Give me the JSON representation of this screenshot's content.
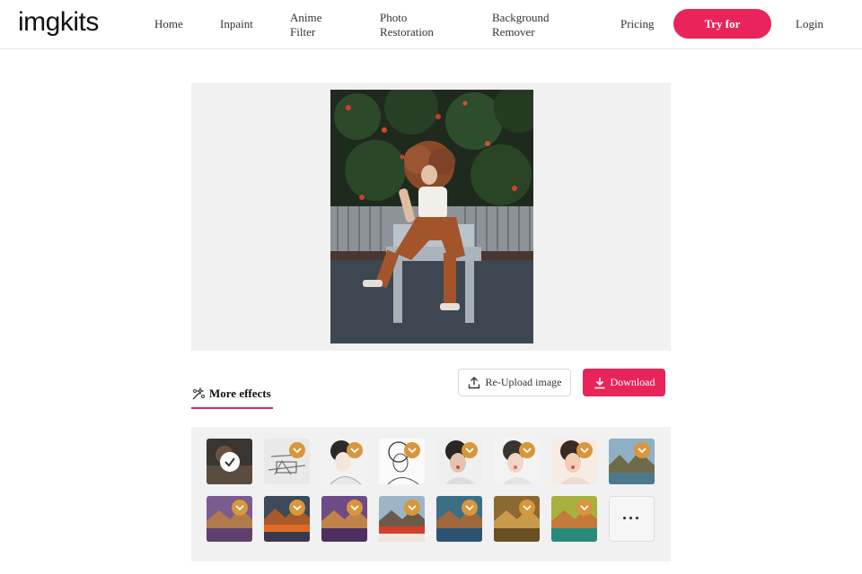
{
  "header": {
    "logo": "imgkits",
    "nav": {
      "home": "Home",
      "inpaint": "Inpaint",
      "anime": "Anime Filter",
      "photo": "Photo Restoration",
      "background": "Background Remover",
      "pricing": "Pricing",
      "login": "Login"
    },
    "try_label": "Try for"
  },
  "actions": {
    "reupload_label": "Re-Upload image",
    "download_label": "Download"
  },
  "tabs": {
    "more_effects_label": "More effects"
  },
  "effects": {
    "more_label": "···",
    "items": [
      {
        "style": "original-dark",
        "selected": true
      },
      {
        "style": "pencil-sketch",
        "premium": true
      },
      {
        "style": "portrait-sketch",
        "premium": true
      },
      {
        "style": "line-art",
        "premium": true
      },
      {
        "style": "color-portrait",
        "premium": true
      },
      {
        "style": "soft-portrait",
        "premium": true
      },
      {
        "style": "warm-portrait",
        "premium": true
      },
      {
        "style": "landscape-blue",
        "premium": true
      },
      {
        "style": "landscape-purple",
        "premium": true
      },
      {
        "style": "landscape-orange",
        "premium": true
      },
      {
        "style": "landscape-violet",
        "premium": true
      },
      {
        "style": "landscape-red",
        "premium": true
      },
      {
        "style": "landscape-teal",
        "premium": true
      },
      {
        "style": "landscape-gold",
        "premium": true
      },
      {
        "style": "landscape-green",
        "premium": true
      }
    ]
  },
  "colors": {
    "accent": "#e8245a",
    "premium_badge": "#d9963a",
    "panel": "#f1f1f1"
  }
}
